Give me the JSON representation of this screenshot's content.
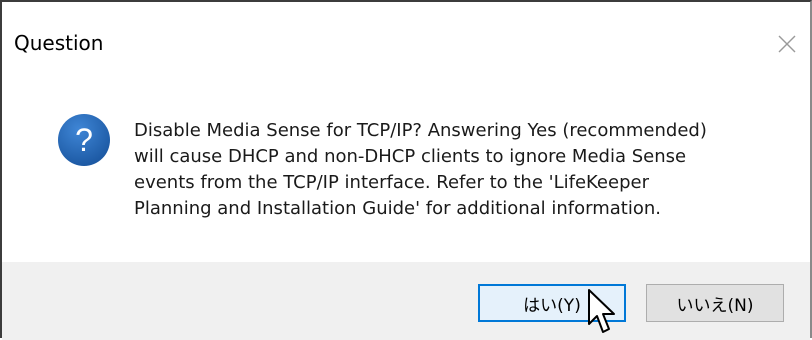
{
  "dialog": {
    "title": "Question",
    "close_icon": "close-icon",
    "icon": "question-icon",
    "message_lines": [
      "Disable Media Sense for TCP/IP? Answering Yes (recommended)",
      "will cause DHCP and non-DHCP clients to ignore Media Sense",
      "events from the TCP/IP interface. Refer to the 'LifeKeeper",
      "Planning and Installation Guide' for additional information."
    ],
    "buttons": {
      "yes_label": "はい(Y)",
      "no_label": "いいえ(N)"
    }
  },
  "colors": {
    "icon_blue": "#1f5fa8",
    "default_button_border": "#0078d7",
    "footer_bg": "#f0f0f0"
  }
}
